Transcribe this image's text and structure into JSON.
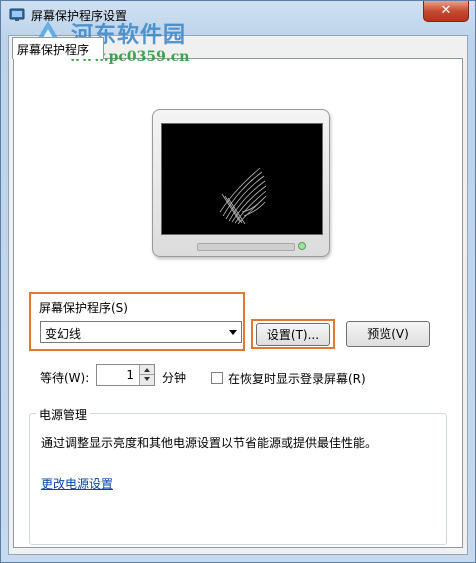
{
  "window": {
    "title": "屏幕保护程序设置",
    "close_label": "✕"
  },
  "watermark": {
    "line1": "河东软件园",
    "line2": "www.pc0359.cn"
  },
  "tabs": [
    {
      "label": "屏幕保护程序",
      "active": true
    }
  ],
  "screensaver": {
    "group_label": "屏幕保护程序(S)",
    "selected": "变幻线",
    "settings_button": "设置(T)...",
    "preview_button": "预览(V)"
  },
  "wait": {
    "label": "等待(W):",
    "value": "1",
    "unit": "分钟"
  },
  "resume_checkbox": {
    "label": "在恢复时显示登录屏幕(R)",
    "checked": false
  },
  "power": {
    "title": "电源管理",
    "description": "通过调整显示亮度和其他电源设置以节省能源或提供最佳性能。",
    "link": "更改电源设置"
  },
  "colors": {
    "highlight": "#e5772e",
    "link": "#0645ad",
    "close_button": "#c74b33"
  },
  "icons": [
    "app-icon",
    "close-icon",
    "dropdown-arrow-icon",
    "spin-up-icon",
    "spin-down-icon"
  ]
}
